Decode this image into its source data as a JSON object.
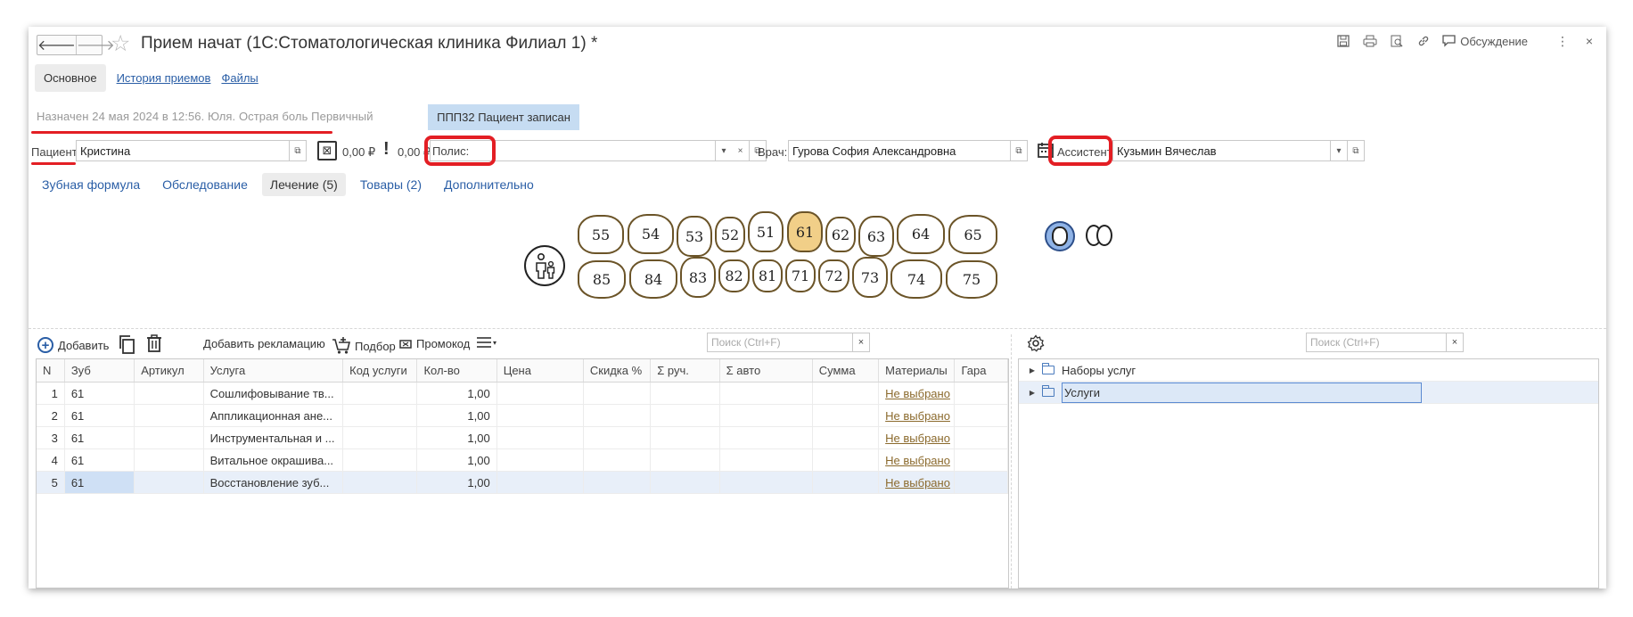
{
  "window": {
    "title": "Прием начат (1С:Стоматологическая клиника Филиал 1) *",
    "header_icons": [
      "save-icon",
      "print-icon",
      "preview-icon",
      "link-icon"
    ],
    "discussion_label": "Обсуждение",
    "more_label": "⋮",
    "close_label": "×"
  },
  "top_tabs": {
    "main": "Основное",
    "history": "История приемов",
    "files": "Файлы"
  },
  "info_line": "Назначен 24 мая 2024  в 12:56. Юля. Острая боль    Первичный",
  "status_badge": "ППП32  Пациент записан",
  "fields": {
    "patient_label": "Пациент:",
    "patient_value": "Кристина",
    "balance1": "0,00 ₽",
    "balance2": "0,00 ₽",
    "policy_label": "Полис:",
    "policy_value": "",
    "doctor_label": "Врач:",
    "doctor_value": "Гурова София Александровна",
    "assistant_label": "Ассистент:",
    "assistant_value": "Кузьмин Вячеслав"
  },
  "sub_tabs": [
    {
      "label": "Зубная формула",
      "active": false
    },
    {
      "label": "Обследование",
      "active": false
    },
    {
      "label": "Лечение (5)",
      "active": true
    },
    {
      "label": "Товары (2)",
      "active": false
    },
    {
      "label": "Дополнительно",
      "active": false
    }
  ],
  "teeth": {
    "upper": [
      "55",
      "54",
      "53",
      "52",
      "51",
      "61",
      "62",
      "63",
      "64",
      "65"
    ],
    "lower": [
      "85",
      "84",
      "83",
      "82",
      "81",
      "71",
      "72",
      "73",
      "74",
      "75"
    ],
    "selected": "61",
    "selected_color": "#f1cf88"
  },
  "toolbar": {
    "add": "Добавить",
    "add_claim": "Добавить рекламацию",
    "pick": "Подбор",
    "promo": "Промокод",
    "search_placeholder": "Поиск (Ctrl+F)"
  },
  "table": {
    "columns": [
      "N",
      "Зуб",
      "Артикул",
      "Услуга",
      "Код услуги",
      "Кол-во",
      "Цена",
      "Скидка %",
      "Σ руч.",
      "Σ авто",
      "Сумма",
      "Материалы",
      "Гара"
    ],
    "rows": [
      {
        "n": "1",
        "zub": "61",
        "article": "",
        "service": "Сошлифовывание тв...",
        "code": "",
        "qty": "1,00",
        "price": "",
        "disc": "",
        "sman": "",
        "sauto": "",
        "sum": "",
        "materials": "Не выбрано",
        "guar": ""
      },
      {
        "n": "2",
        "zub": "61",
        "article": "",
        "service": "Аппликационная ане...",
        "code": "",
        "qty": "1,00",
        "price": "",
        "disc": "",
        "sman": "",
        "sauto": "",
        "sum": "",
        "materials": "Не выбрано",
        "guar": ""
      },
      {
        "n": "3",
        "zub": "61",
        "article": "",
        "service": "Инструментальная и ...",
        "code": "",
        "qty": "1,00",
        "price": "",
        "disc": "",
        "sman": "",
        "sauto": "",
        "sum": "",
        "materials": "Не выбрано",
        "guar": ""
      },
      {
        "n": "4",
        "zub": "61",
        "article": "",
        "service": "Витальное окрашива...",
        "code": "",
        "qty": "1,00",
        "price": "",
        "disc": "",
        "sman": "",
        "sauto": "",
        "sum": "",
        "materials": "Не выбрано",
        "guar": ""
      },
      {
        "n": "5",
        "zub": "61",
        "article": "",
        "service": "Восстановление зуб...",
        "code": "",
        "qty": "1,00",
        "price": "",
        "disc": "",
        "sman": "",
        "sauto": "",
        "sum": "",
        "materials": "Не выбрано",
        "guar": ""
      }
    ]
  },
  "right_panel": {
    "search_placeholder": "Поиск (Ctrl+F)",
    "tree": [
      {
        "label": "Наборы услуг",
        "selected": false
      },
      {
        "label": "Услуги",
        "selected": true
      }
    ]
  },
  "colors": {
    "accent_link": "#2a5ea6",
    "highlight_red": "#e31e24",
    "status_badge_bg": "#c6dcf2",
    "selected_row": "#e8eff9"
  }
}
